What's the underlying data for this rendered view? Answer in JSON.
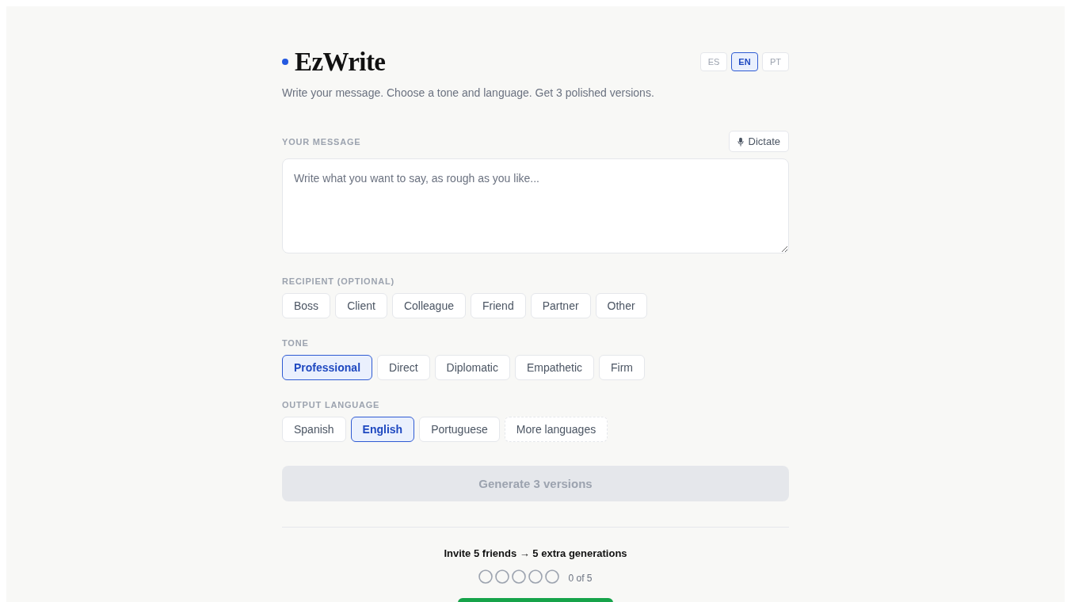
{
  "brand": {
    "name": "EzWrite"
  },
  "ui_languages": [
    {
      "label": "ES",
      "selected": false
    },
    {
      "label": "EN",
      "selected": true
    },
    {
      "label": "PT",
      "selected": false
    }
  ],
  "tagline": "Write your message. Choose a tone and language. Get 3 polished versions.",
  "message": {
    "label": "YOUR MESSAGE",
    "dictate_button": "Dictate",
    "placeholder": "Write what you want to say, as rough as you like..."
  },
  "sections": [
    {
      "label": "RECIPIENT (OPTIONAL)",
      "options": [
        {
          "label": "Boss",
          "selected": false,
          "kind": "option"
        },
        {
          "label": "Client",
          "selected": false,
          "kind": "option"
        },
        {
          "label": "Colleague",
          "selected": false,
          "kind": "option"
        },
        {
          "label": "Friend",
          "selected": false,
          "kind": "option"
        },
        {
          "label": "Partner",
          "selected": false,
          "kind": "option"
        },
        {
          "label": "Other",
          "selected": false,
          "kind": "option"
        }
      ]
    },
    {
      "label": "TONE",
      "options": [
        {
          "label": "Professional",
          "selected": true,
          "kind": "option"
        },
        {
          "label": "Direct",
          "selected": false,
          "kind": "option"
        },
        {
          "label": "Diplomatic",
          "selected": false,
          "kind": "option"
        },
        {
          "label": "Empathetic",
          "selected": false,
          "kind": "option"
        },
        {
          "label": "Firm",
          "selected": false,
          "kind": "option"
        }
      ]
    },
    {
      "label": "OUTPUT LANGUAGE",
      "options": [
        {
          "label": "Spanish",
          "selected": false,
          "kind": "option"
        },
        {
          "label": "English",
          "selected": true,
          "kind": "option"
        },
        {
          "label": "Portuguese",
          "selected": false,
          "kind": "option"
        },
        {
          "label": "More languages",
          "selected": false,
          "kind": "more"
        }
      ]
    }
  ],
  "generate_button": {
    "label": "Generate 3 versions",
    "disabled": true
  },
  "invite": {
    "title": "Invite 5 friends → 5 extra generations",
    "slots": [
      {
        "filled": false
      },
      {
        "filled": false
      },
      {
        "filled": false
      },
      {
        "filled": false
      },
      {
        "filled": false
      }
    ],
    "count": "0 of 5"
  }
}
